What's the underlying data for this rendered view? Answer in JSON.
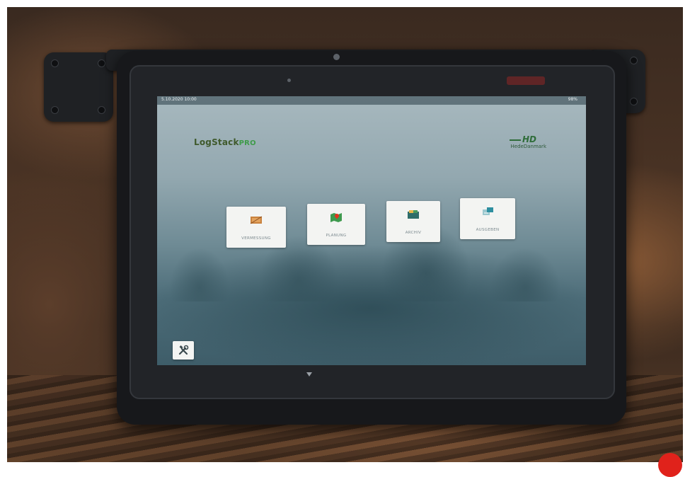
{
  "status_bar": {
    "datetime": "5.10.2020 10:00",
    "right_text": "98%"
  },
  "branding": {
    "app_logo_main": "LogStack",
    "app_logo_suffix": "PRO",
    "partner_mark": "HD",
    "partner_name": "HedeDanmark"
  },
  "menu": {
    "tiles": [
      {
        "label": "VERMESSUNG",
        "icon": "stack-icon"
      },
      {
        "label": "PLANUNG",
        "icon": "map-pin-icon"
      },
      {
        "label": "ARCHIV",
        "icon": "archive-box-icon"
      },
      {
        "label": "AUSGEBEN",
        "icon": "export-icon"
      }
    ],
    "tools_icon": "tools-icon"
  },
  "colors": {
    "logo_green": "#3f9b4a",
    "logo_dark": "#3f5a2c",
    "tile_bg": "#f3f4f2",
    "tablet_body": "#17181b"
  }
}
